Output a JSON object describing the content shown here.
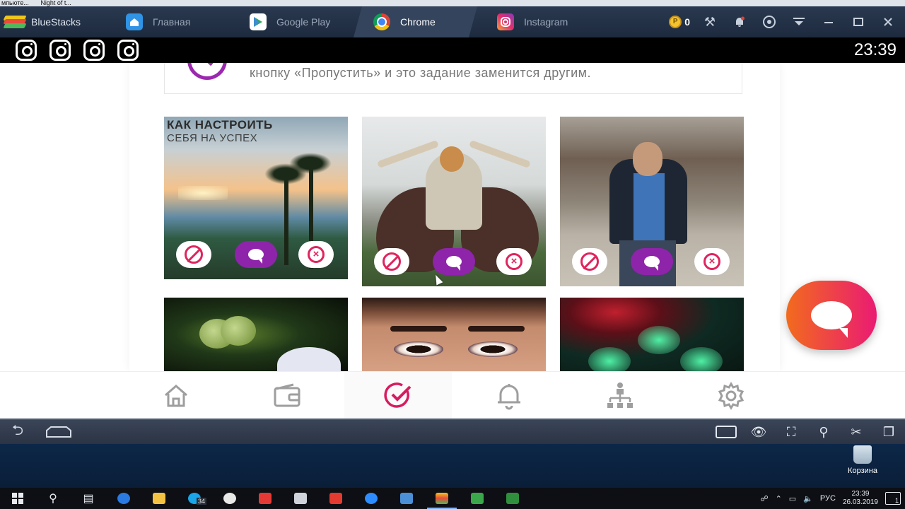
{
  "top_strip": {
    "items": [
      "мпьюте...",
      "Night of t..."
    ]
  },
  "bluestacks": {
    "app_name": "BlueStacks",
    "tabs": [
      {
        "label": "Главная",
        "icon": "home-icon",
        "active": false
      },
      {
        "label": "Google Play",
        "icon": "play-store-icon",
        "active": false
      },
      {
        "label": "Chrome",
        "icon": "chrome-icon",
        "active": true
      },
      {
        "label": "Instagram",
        "icon": "instagram-icon",
        "active": false
      }
    ],
    "coins": "0"
  },
  "status_bar": {
    "time": "23:39",
    "notification_icons": [
      "instagram-icon",
      "instagram-icon",
      "instagram-icon",
      "instagram-icon"
    ]
  },
  "app": {
    "notice_text": "кнопку «Пропустить» и это задание заменится другим.",
    "post_caption_line1": "КАК НАСТРОИТЬ",
    "post_caption_line2": "СЕБЯ НА УСПЕХ",
    "post_actions": [
      "skip-icon",
      "comment-icon",
      "close-icon"
    ],
    "accent_color": "#8e24aa",
    "danger_color": "#e0245e",
    "nav_items": [
      "home-icon",
      "wallet-icon",
      "tasks-check-icon",
      "bell-icon",
      "referrals-tree-icon",
      "settings-gear-icon"
    ],
    "active_nav": "tasks-check-icon"
  },
  "desktop": {
    "recycle_bin_label": "Корзина"
  },
  "taskbar": {
    "language": "РУС",
    "time": "23:39",
    "date": "26.03.2019",
    "skype_badge": "34",
    "notification_badge": "1"
  }
}
